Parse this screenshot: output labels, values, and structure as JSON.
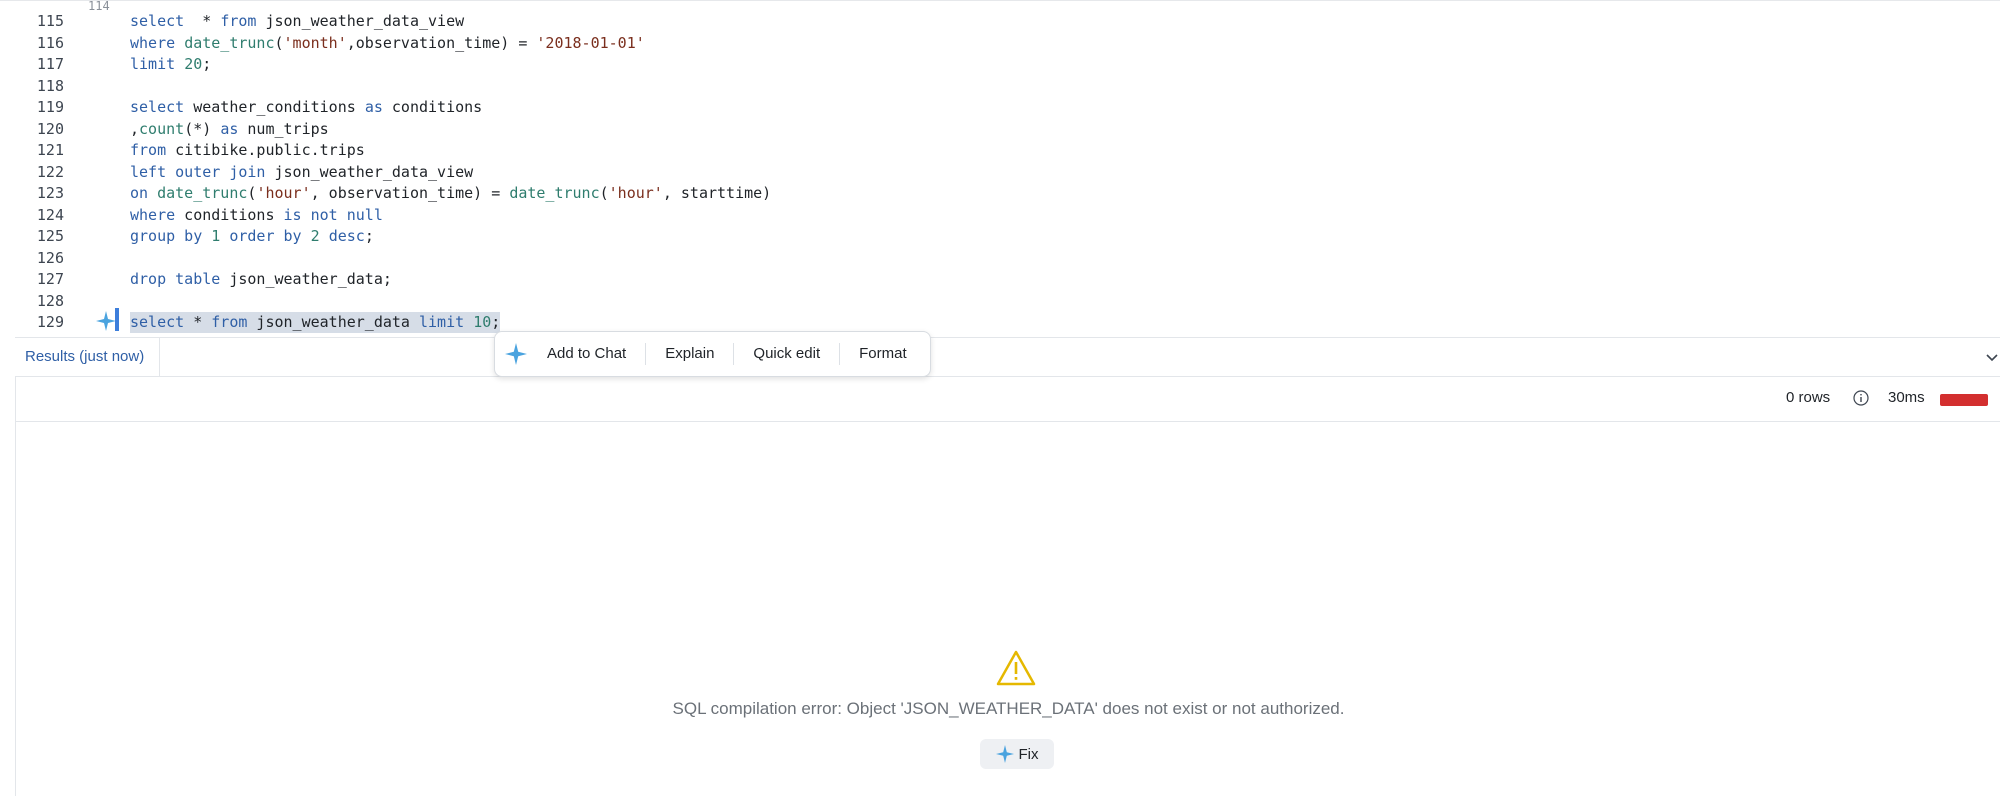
{
  "editor": {
    "partial_top_line": "114",
    "lines": [
      {
        "n": "115",
        "tokens": [
          [
            "kw",
            "select"
          ],
          [
            "",
            "  * "
          ],
          [
            "kw",
            "from"
          ],
          [
            "",
            " json_weather_data_view"
          ]
        ]
      },
      {
        "n": "116",
        "tokens": [
          [
            "kw",
            "where"
          ],
          [
            "",
            " "
          ],
          [
            "fn",
            "date_trunc"
          ],
          [
            "",
            "("
          ],
          [
            "str",
            "'month'"
          ],
          [
            "",
            ",observation_time) = "
          ],
          [
            "str",
            "'2018-01-01'"
          ]
        ]
      },
      {
        "n": "117",
        "tokens": [
          [
            "kw",
            "limit"
          ],
          [
            "",
            " "
          ],
          [
            "num",
            "20"
          ],
          [
            "",
            ";"
          ]
        ]
      },
      {
        "n": "118",
        "tokens": []
      },
      {
        "n": "119",
        "tokens": [
          [
            "kw",
            "select"
          ],
          [
            "",
            " weather_conditions "
          ],
          [
            "kw",
            "as"
          ],
          [
            "",
            " conditions"
          ]
        ]
      },
      {
        "n": "120",
        "tokens": [
          [
            "",
            ","
          ],
          [
            "fn",
            "count"
          ],
          [
            "",
            "(*) "
          ],
          [
            "kw",
            "as"
          ],
          [
            "",
            " num_trips"
          ]
        ]
      },
      {
        "n": "121",
        "tokens": [
          [
            "kw",
            "from"
          ],
          [
            "",
            " citibike.public.trips"
          ]
        ]
      },
      {
        "n": "122",
        "tokens": [
          [
            "kw",
            "left outer join"
          ],
          [
            "",
            " json_weather_data_view"
          ]
        ]
      },
      {
        "n": "123",
        "tokens": [
          [
            "kw",
            "on"
          ],
          [
            "",
            " "
          ],
          [
            "fn",
            "date_trunc"
          ],
          [
            "",
            "("
          ],
          [
            "str",
            "'hour'"
          ],
          [
            "",
            ", observation_time) = "
          ],
          [
            "fn",
            "date_trunc"
          ],
          [
            "",
            "("
          ],
          [
            "str",
            "'hour'"
          ],
          [
            "",
            ", starttime)"
          ]
        ]
      },
      {
        "n": "124",
        "tokens": [
          [
            "kw",
            "where"
          ],
          [
            "",
            " conditions "
          ],
          [
            "kw",
            "is not null"
          ]
        ]
      },
      {
        "n": "125",
        "tokens": [
          [
            "kw",
            "group by"
          ],
          [
            "",
            " "
          ],
          [
            "num",
            "1"
          ],
          [
            "",
            " "
          ],
          [
            "kw",
            "order by"
          ],
          [
            "",
            " "
          ],
          [
            "num",
            "2"
          ],
          [
            "",
            " "
          ],
          [
            "kw",
            "desc"
          ],
          [
            "",
            ";"
          ]
        ]
      },
      {
        "n": "126",
        "tokens": []
      },
      {
        "n": "127",
        "tokens": [
          [
            "kw",
            "drop table"
          ],
          [
            "",
            " json_weather_data;"
          ]
        ]
      },
      {
        "n": "128",
        "tokens": []
      },
      {
        "n": "129",
        "selected": true,
        "tokens": [
          [
            "kw",
            "select"
          ],
          [
            "",
            " * "
          ],
          [
            "kw",
            "from"
          ],
          [
            "",
            " json_weather_data "
          ],
          [
            "kw",
            "limit"
          ],
          [
            "",
            " "
          ],
          [
            "num",
            "10"
          ],
          [
            "",
            ";"
          ]
        ]
      }
    ]
  },
  "toolbar": {
    "add_to_chat": "Add to Chat",
    "explain": "Explain",
    "quick_edit": "Quick edit",
    "format": "Format"
  },
  "results": {
    "tab_label": "Results (just now)",
    "rows": "0 rows",
    "duration": "30ms",
    "error_message": "SQL compilation error: Object 'JSON_WEATHER_DATA' does not exist or not authorized.",
    "fix_label": "Fix"
  },
  "colors": {
    "accent": "#2f5fa6",
    "error_bar": "#d32f2f",
    "warning": "#e5b800",
    "spark": "#4aa3df"
  }
}
